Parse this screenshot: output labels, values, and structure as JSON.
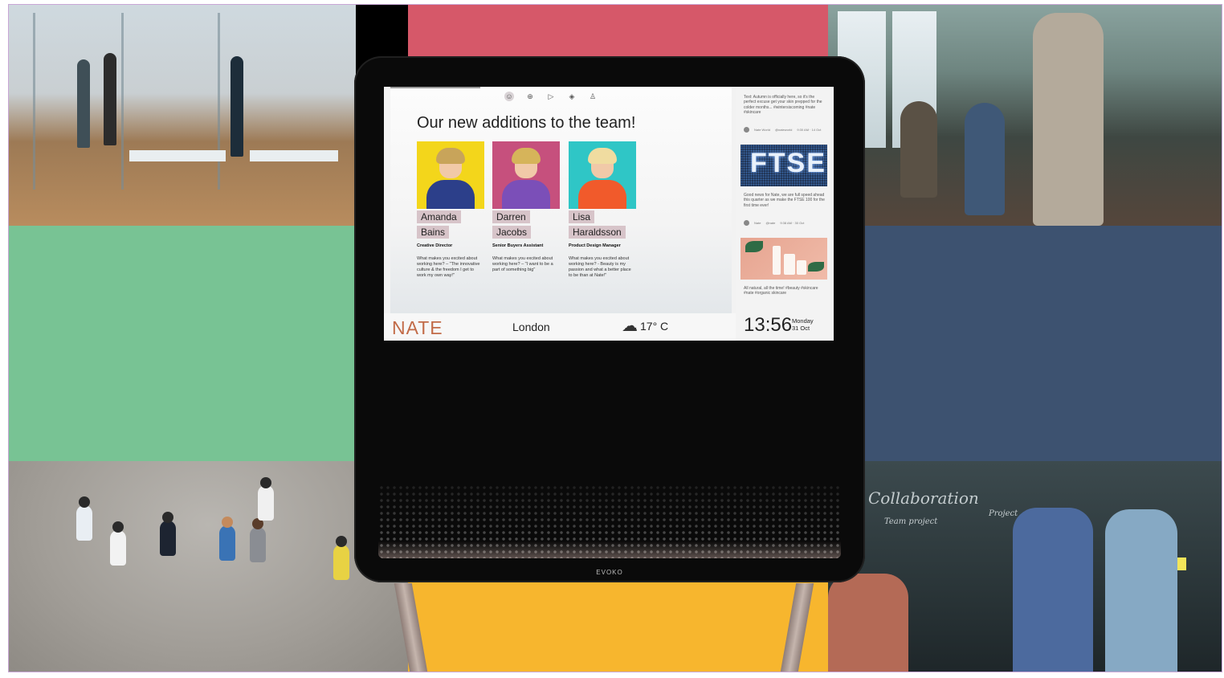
{
  "screen": {
    "headline": "Our new additions to the team!",
    "team": [
      {
        "first": "Amanda",
        "last": "Bains",
        "role": "Creative Director",
        "quote": "What makes you excited about working here? – \"The innovative culture & the freedom I get to work my own way!\""
      },
      {
        "first": "Darren",
        "last": "Jacobs",
        "role": "Senior Buyers Assistant",
        "quote": "What makes you excited about working here? – \"I want to be a part of something big\""
      },
      {
        "first": "Lisa",
        "last": "Haraldsson",
        "role": "Product Design Manager",
        "quote": "What makes you excited about working here? - Beauty is my passion and what a better place to be than at Nate!\""
      }
    ],
    "footer": {
      "logo": "NATE",
      "city": "London",
      "temperature": "17° C",
      "time": "13:56",
      "day": "Monday",
      "date": "31 Oct"
    },
    "feed": {
      "tweet1": "Text: Autumn is officially here, so it's the perfect excuse get your skin prepped for the colder months... #wintersiscoming #nate #skincare",
      "tweet1_account": "Nate World",
      "tweet1_handle": "@nateworld",
      "tweet1_time": "9:30 AM · 14 Oct",
      "ftse_label": "FTSE",
      "tweet2": "Good news for Nate, we are full speed ahead this quarter as we make the FTSE 100 for the first time ever!",
      "tweet2_account": "Nate",
      "tweet2_handle": "@nate",
      "tweet2_time": "9:38 AM · 30 Oct",
      "tweet3": "All natural, all the time! #beauty #skincare #nate #organic skincare"
    }
  },
  "device": {
    "brand": "EVOKO"
  },
  "icons": {
    "nav": [
      "person-icon",
      "globe-icon",
      "play-icon",
      "diamond-icon",
      "person-add-icon"
    ],
    "nav_glyphs": [
      "☺",
      "⊕",
      "▷",
      "◈",
      "♙"
    ],
    "weather": "rain-cloud-icon",
    "weather_glyph": "☁"
  },
  "colors": {
    "accent": "#c26b48",
    "name_badge": "#d7c4c9",
    "pink_tile": "#d65869",
    "green_tile": "#78c394",
    "blue_tile": "#3d5270",
    "yellow_tile": "#f7b62e"
  }
}
